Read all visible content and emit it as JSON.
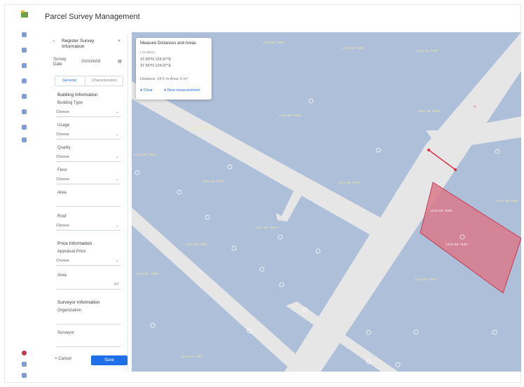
{
  "app": {
    "title": "Parcel Survey Management"
  },
  "panel": {
    "header": "Register Survey Information",
    "survey_date_label": "Survey Date",
    "survey_date_value": "2023/06/08",
    "tabs": [
      "General",
      "Characteristics"
    ],
    "building_section": "Building Information",
    "fields": [
      {
        "label": "Building Type",
        "value": "Choose"
      },
      {
        "label": "Usage",
        "value": "Choose"
      },
      {
        "label": "Quality",
        "value": "Choose"
      },
      {
        "label": "Floor",
        "value": "Choose"
      },
      {
        "label": "Area",
        "value": ""
      },
      {
        "label": "Roof",
        "value": "Choose"
      }
    ],
    "price_section": "Price Information",
    "price_fields": [
      {
        "label": "Appraisal Price",
        "value": "Choose"
      },
      {
        "label": "Area",
        "value": "m²"
      }
    ],
    "surveyor_section": "Surveyor Information",
    "surveyor_fields": [
      {
        "label": "Organization",
        "value": ""
      },
      {
        "label": "Surveyor",
        "value": ""
      }
    ],
    "cancel": "Cancel",
    "submit": "Save"
  },
  "overlay": {
    "title": "Measure Distances and Areas",
    "sub": "Location",
    "coord1": "37.56°N 126.97°E",
    "coord2": "37.56°N 126.97°E",
    "result": "Distance: 24.5 m  Area: 0 m²",
    "btn_clear": "Clear",
    "btn_measure": "New measurement"
  },
  "map": {
    "parcel_labels": [
      "1234-56 7890",
      "1234-56 7890",
      "1234-56 7890",
      "1234-56 7890",
      "1234-56 7890",
      "1234-56 7890",
      "1234-56 7890",
      "1234-56 7890",
      "1234-56 7890",
      "1234-56 7890",
      "1234-56 7890",
      "1234-56 7890",
      "1234-56 7890",
      "1234-56 7890",
      "1234-56 7890"
    ],
    "selected_label": "1234-56 7890",
    "selected_sublabel": "1234-56 7890"
  },
  "colors": {
    "accent": "#1e6fe8",
    "map_bg": "#aebfd9",
    "road": "#e6e6e6",
    "selected_fill": "#d9798a",
    "selected_stroke": "#c8384f"
  }
}
